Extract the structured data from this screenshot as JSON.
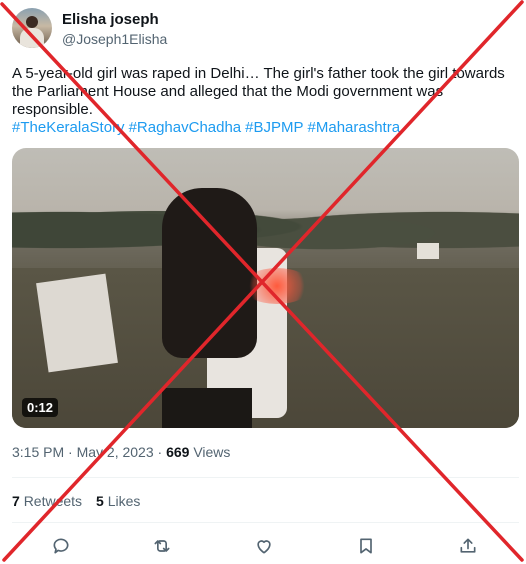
{
  "tweet": {
    "author": {
      "display_name": "Elisha joseph",
      "handle": "@Joseph1Elisha",
      "avatar_icon": "profile-photo"
    },
    "text": "A 5-year-old girl was raped in Delhi… The girl's father took the girl towards the Parliament House and alleged that the Modi government was responsible.",
    "hashtags": [
      "#TheKeralaStory",
      "#RaghavChadha",
      "#BJPMP",
      "#Maharashtra"
    ],
    "video": {
      "duration": "0:12"
    },
    "meta": {
      "time_date": "3:15 PM · May 2, 2023 ·",
      "views_count": "669",
      "views_label": "Views"
    },
    "stats": {
      "retweets_count": "7",
      "retweets_label": "Retweets",
      "likes_count": "5",
      "likes_label": "Likes"
    },
    "actions": [
      {
        "name": "reply",
        "icon": "reply-icon"
      },
      {
        "name": "retweet",
        "icon": "retweet-icon"
      },
      {
        "name": "like",
        "icon": "heart-icon"
      },
      {
        "name": "bookmark",
        "icon": "bookmark-icon"
      },
      {
        "name": "share",
        "icon": "share-icon"
      }
    ]
  },
  "overlay": {
    "type": "red-cross",
    "color": "#e0262b"
  },
  "colors": {
    "link": "#1d9bf0",
    "secondary_text": "#536471",
    "primary_text": "#0f1419"
  }
}
